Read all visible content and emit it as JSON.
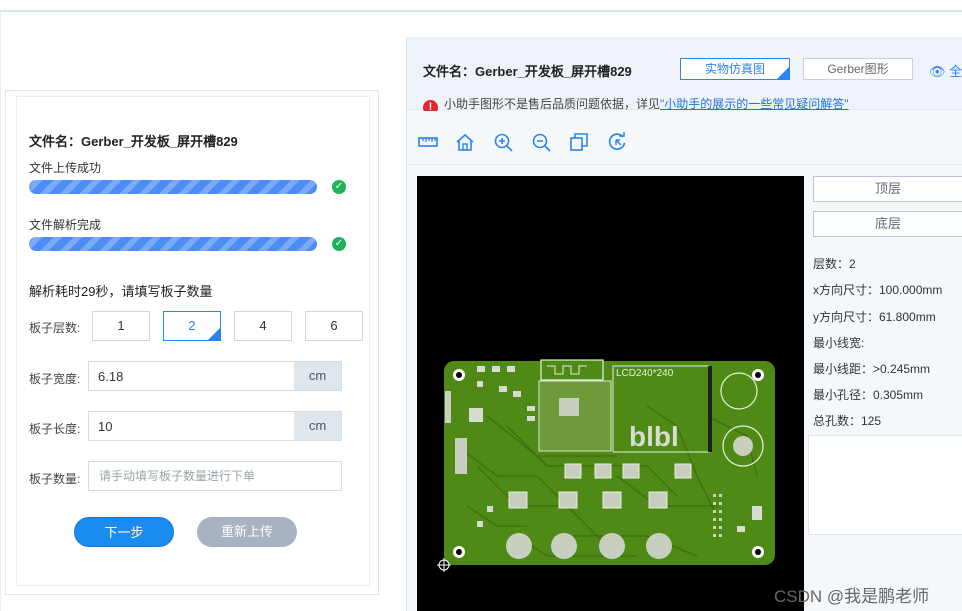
{
  "upload": {
    "file_title": "文件名：Gerber_开发板_屏开槽829",
    "step_upload": "文件上传成功",
    "step_parse": "文件解析完成",
    "parse_message": "解析耗时29秒，请填写板子数量",
    "layers_label": "板子层数:",
    "layer_options": [
      "1",
      "2",
      "4",
      "6"
    ],
    "layer_selected": "2",
    "width_label": "板子宽度:",
    "width_value": "6.18",
    "width_unit": "cm",
    "length_label": "板子长度:",
    "length_value": "10",
    "length_unit": "cm",
    "qty_label": "板子数量:",
    "qty_placeholder": "请手动填写板子数量进行下单",
    "next_label": "下一步",
    "reupload_label": "重新上传"
  },
  "preview": {
    "file_title": "文件名：Gerber_开发板_屏开槽829",
    "tab_real": "实物仿真图",
    "tab_gerber": "Gerber图形",
    "fullscreen_label": "全",
    "warning_text": "小助手图形不是售后品质问题依据，详见",
    "warning_link": "\"小助手的展示的一些常见疑问解答\"",
    "side_top": "顶层",
    "side_bottom": "底层",
    "info": [
      "层数：2",
      "x方向尺寸：100.000mm",
      "y方向尺寸：61.800mm",
      "最小线宽:",
      "最小线距：>0.245mm",
      "最小孔径：0.305mm",
      "总孔数：125"
    ],
    "pcb_text": "LCD240*240",
    "pcb_text2": "blbl"
  },
  "watermark": "CSDN @我是鹏老师",
  "colors": {
    "accent": "#2a84ef",
    "pcb_green": "#4f8a17",
    "success": "#1fb25a",
    "warning": "#e0272d"
  }
}
